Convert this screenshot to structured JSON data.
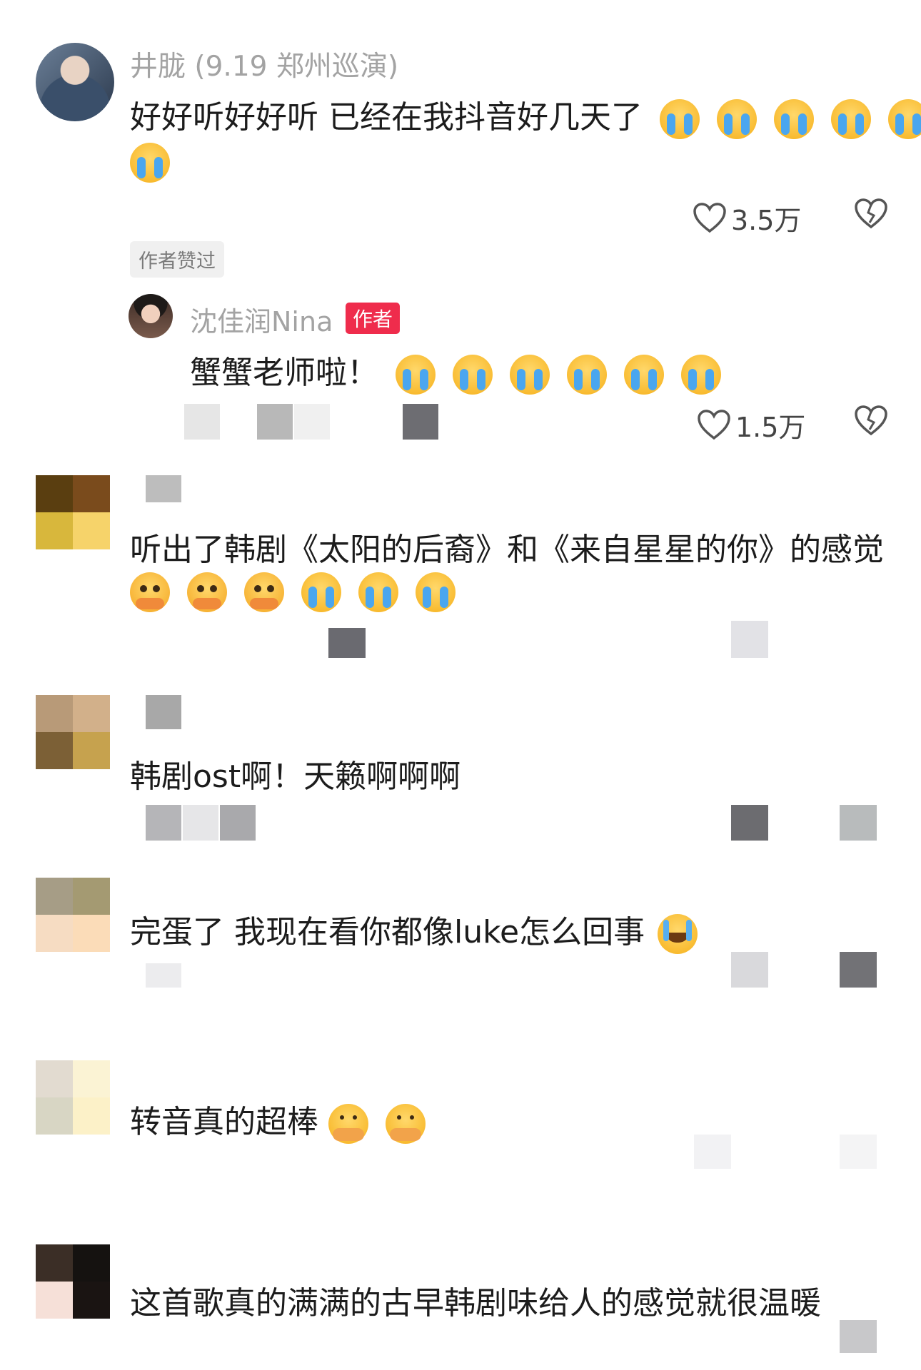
{
  "colors": {
    "background": "#ffffff",
    "username": "#a3a3a3",
    "text": "#1c1c1c",
    "author_badge": "#ef2c4c",
    "liked_badge_bg": "#f0f0f0"
  },
  "comments": [
    {
      "username": "井胧 (9.19 郑州巡演)",
      "text_line1": "好好听好好听 已经在我抖音好几天了",
      "emoji_names": [
        "loudly-crying-emoji",
        "loudly-crying-emoji",
        "loudly-crying-emoji",
        "loudly-crying-emoji",
        "loudly-crying-emoji",
        "loudly-crying-emoji"
      ],
      "likes": "3.5万",
      "liked_badge": "作者赞过",
      "reply": {
        "username": "沈佳润Nina",
        "author_badge": "作者",
        "text": "蟹蟹老师啦！",
        "emoji_names": [
          "loudly-crying-emoji",
          "loudly-crying-emoji",
          "loudly-crying-emoji",
          "loudly-crying-emoji",
          "loudly-crying-emoji",
          "loudly-crying-emoji"
        ],
        "likes": "1.5万"
      }
    },
    {
      "text": "听出了韩剧《太阳的后裔》和《来自星星的你》的感觉",
      "emoji_names": [
        "holding-back-tears-emoji",
        "holding-back-tears-emoji",
        "holding-back-tears-emoji",
        "loudly-crying-emoji",
        "loudly-crying-emoji",
        "loudly-crying-emoji"
      ]
    },
    {
      "text": "韩剧ost啊！天籁啊啊啊"
    },
    {
      "text": "完蛋了 我现在看你都像luke怎么回事",
      "emoji_names": [
        "crying-with-laughter-emoji"
      ]
    },
    {
      "text": "转音真的超棒",
      "emoji_names": [
        "moved-emoji",
        "moved-emoji"
      ]
    },
    {
      "text": "这首歌真的满满的古早韩剧味给人的感觉就很温暖"
    }
  ]
}
